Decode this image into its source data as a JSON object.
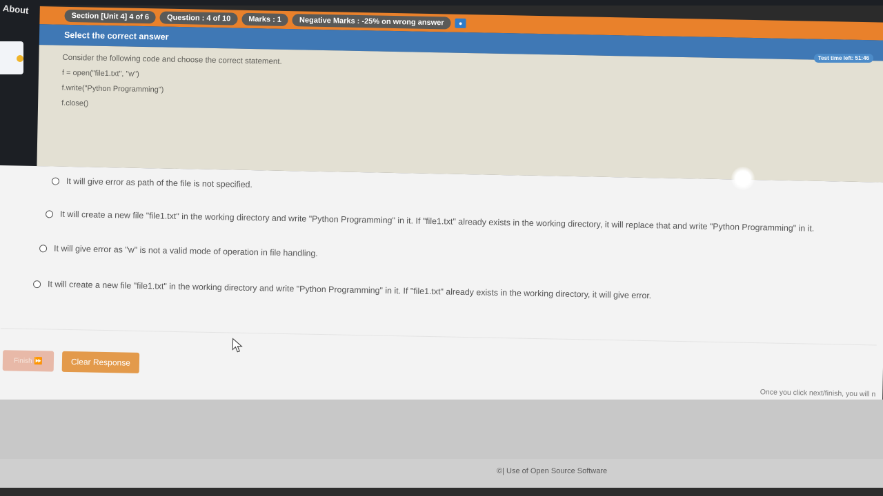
{
  "sidebar": {
    "about_label": "About"
  },
  "header": {
    "section": "Section [Unit 4] 4 of 6",
    "question": "Question : 4 of 10",
    "marks": "Marks : 1",
    "negative_marks": "Negative Marks : -25% on wrong answer",
    "info_icon": "info-icon"
  },
  "instruction": "Select the correct answer",
  "timer": "Test time left: 51:46",
  "question": {
    "prompt": "Consider the following code and choose the correct statement.",
    "code": [
      "f = open(\"file1.txt\", \"w\")",
      "f.write(\"Python Programming\")",
      "f.close()"
    ]
  },
  "options": [
    "It will give error as path of the file is not specified.",
    "It will create a new file \"file1.txt\" in the working directory and write \"Python Programming\" in it. If \"file1.txt\" already exists in the working directory, it will replace that and write \"Python Programming\" in it.",
    "It will give error as \"w\" is not a valid mode of operation in file handling.",
    "It will create a new file \"file1.txt\" in the working directory and write \"Python Programming\" in it. If \"file1.txt\" already exists in the working directory, it will give error."
  ],
  "buttons": {
    "finish": "Finish ⏩",
    "clear_response": "Clear Response"
  },
  "notice": "Once you click next/finish, you will n",
  "footer": "©| Use of Open Source Software",
  "colors": {
    "header_orange": "#e9812b",
    "instruction_blue": "#3f78b5",
    "clear_button": "#e39a4b"
  }
}
